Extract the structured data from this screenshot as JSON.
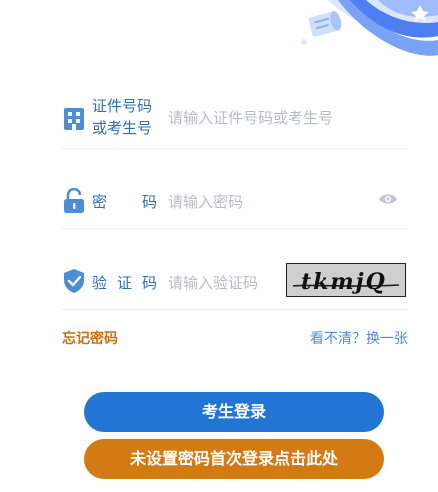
{
  "form": {
    "id_label_line1": "证件号码",
    "id_label_line2": "或考生号",
    "id_placeholder": "请输入证件号码或考生号",
    "password_label_char1": "密",
    "password_label_char2": "码",
    "password_placeholder": "请输入密码",
    "captcha_label_char1": "验",
    "captcha_label_char2": "证",
    "captcha_label_char3": "码",
    "captcha_placeholder": "请输入验证码",
    "captcha_text": "tkmjQ"
  },
  "links": {
    "forgot_password": "忘记密码",
    "refresh_captcha": "看不清？换一张"
  },
  "buttons": {
    "login": "考生登录",
    "first_login": "未设置密码首次登录点击此处"
  },
  "icons": {
    "id": "building-id-icon",
    "password": "lock-icon",
    "captcha": "shield-check-icon",
    "show_password": "eye-icon"
  },
  "colors": {
    "primary": "#2275d4",
    "accent": "#d47a15",
    "label": "#2f6fb8"
  }
}
